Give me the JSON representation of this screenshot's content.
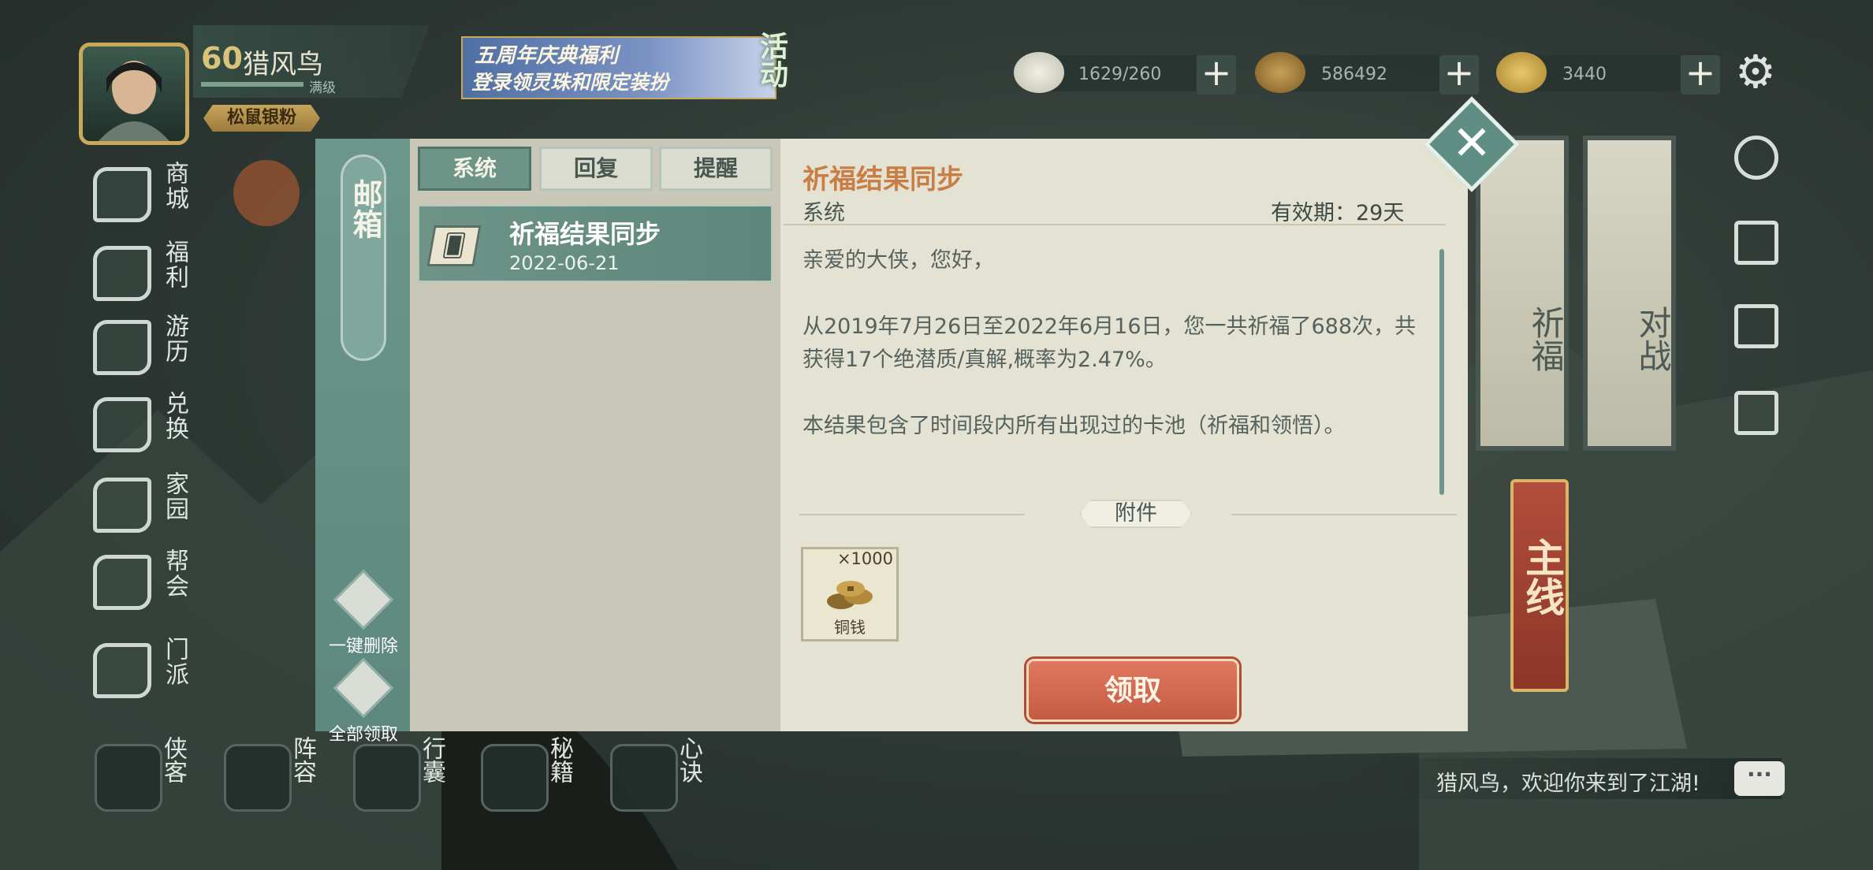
{
  "player": {
    "level": "60",
    "name": "猎风鸟",
    "exp_label": "满级",
    "title_badge": "松鼠银粉"
  },
  "event_banner": {
    "line1": "五周年庆典福利",
    "line2": "登录领灵珠和限定装扮",
    "tag": "活动"
  },
  "resources": [
    {
      "icon": "bun-icon",
      "value": "1629/260"
    },
    {
      "icon": "copper-coin-icon",
      "value": "586492"
    },
    {
      "icon": "gold-ingot-icon",
      "value": "3440"
    }
  ],
  "left_menu": [
    {
      "label": "商城",
      "icon": "shop-icon"
    },
    {
      "label": "福利",
      "icon": "welfare-icon"
    },
    {
      "label": "游历",
      "icon": "horse-icon"
    },
    {
      "label": "兑换",
      "icon": "exchange-icon"
    },
    {
      "label": "家园",
      "icon": "home-icon"
    },
    {
      "label": "帮会",
      "icon": "guild-icon"
    },
    {
      "label": "门派",
      "icon": "sect-icon"
    }
  ],
  "bottom_nav": [
    {
      "label": "侠客",
      "icon": "hero-icon"
    },
    {
      "label": "阵容",
      "icon": "formation-icon"
    },
    {
      "label": "行囊",
      "icon": "bag-icon"
    },
    {
      "label": "秘籍",
      "icon": "manual-icon"
    },
    {
      "label": "心诀",
      "icon": "mind-icon"
    }
  ],
  "right_scrolls": {
    "pray": "祈福",
    "battle": "对战",
    "main": "主线"
  },
  "chat": {
    "message": "猎风鸟，欢迎你来到了江湖!",
    "button": "···"
  },
  "mailbox": {
    "title": "邮箱",
    "delete_all": "一键删除",
    "claim_all": "全部领取",
    "tabs": [
      "系统",
      "回复",
      "提醒"
    ],
    "active_tab": 0,
    "mails": [
      {
        "title": "祈福结果同步",
        "date": "2022-06-21"
      }
    ],
    "content": {
      "title": "祈福结果同步",
      "sender": "系统",
      "validity": "有效期：29天",
      "paragraphs": [
        "亲爱的大侠，您好，",
        "从2019年7月26日至2022年6月16日，您一共祈福了688次，共获得17个绝潜质/真解,概率为2.47%。",
        "本结果包含了时间段内所有出现过的卡池（祈福和领悟）。"
      ],
      "attachments_label": "附件",
      "attachment": {
        "name": "铜钱",
        "quantity": "×1000"
      },
      "claim_button": "领取"
    }
  }
}
